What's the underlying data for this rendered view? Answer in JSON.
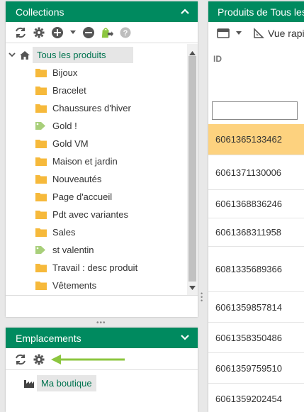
{
  "collections": {
    "title": "Collections",
    "items": [
      {
        "label": "Tous les produits",
        "icon": "home-icon",
        "selected": true
      },
      {
        "label": "Bijoux",
        "icon": "folder-icon"
      },
      {
        "label": "Bracelet",
        "icon": "folder-icon"
      },
      {
        "label": "Chaussures d'hiver",
        "icon": "folder-icon"
      },
      {
        "label": "Gold !",
        "icon": "tag-icon"
      },
      {
        "label": "Gold VM",
        "icon": "folder-icon"
      },
      {
        "label": "Maison et jardin",
        "icon": "folder-icon"
      },
      {
        "label": "Nouveautés",
        "icon": "folder-icon"
      },
      {
        "label": "Page d'accueil",
        "icon": "folder-icon"
      },
      {
        "label": "Pdt avec variantes",
        "icon": "folder-icon"
      },
      {
        "label": "Sales",
        "icon": "folder-icon"
      },
      {
        "label": "st valentin",
        "icon": "tag-icon"
      },
      {
        "label": "Travail : desc produit",
        "icon": "folder-icon"
      },
      {
        "label": "Vêtements",
        "icon": "folder-icon"
      }
    ]
  },
  "emplacements": {
    "title": "Emplacements",
    "items": [
      {
        "label": "Ma boutique",
        "icon": "factory-icon"
      }
    ]
  },
  "products": {
    "title": "Produits de Tous les",
    "toolbar_view_label": "Vue rapi",
    "column_id": "ID",
    "filter_value": "",
    "rows": [
      "6061365133462",
      "6061371130006",
      "6061368836246",
      "6061368311958",
      "6081335689366",
      "6061359857814",
      "6061358350486",
      "6061359759510",
      "6061359202454"
    ]
  },
  "colors": {
    "header_green": "#008a5f",
    "selected_row": "#fdd27f",
    "arrow_green": "#8cc63f"
  }
}
